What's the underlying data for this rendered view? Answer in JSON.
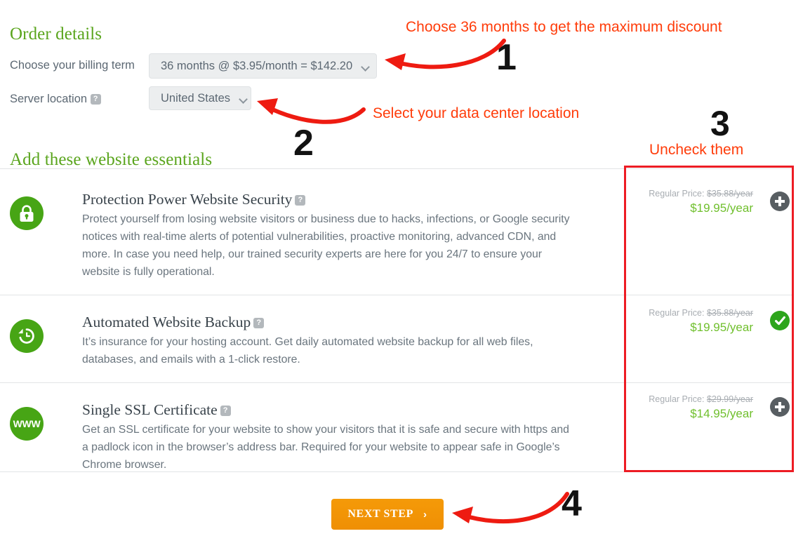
{
  "order": {
    "heading": "Order details",
    "billing_label": "Choose your billing term",
    "billing_value": "36 months @ $3.95/month = $142.20",
    "location_label": "Server location",
    "location_value": "United States",
    "help_glyph": "?"
  },
  "essentials": {
    "heading": "Add these website essentials",
    "products": [
      {
        "icon": "padlock-icon",
        "title": "Protection Power Website Security",
        "description": "Protect yourself from losing website visitors or business due to hacks, infections, or Google security notices with real-time alerts of potential vulnerabilities, proactive monitoring, advanced CDN, and more. In case you need help, our trained security experts are here for you 24/7 to ensure your website is fully operational.",
        "regular_price_label": "Regular Price:",
        "regular_price": "$35.88/year",
        "sale_price": "$19.95/year",
        "state": "add",
        "toggle_icon": "plus-icon"
      },
      {
        "icon": "backup-restore-icon",
        "title": "Automated Website Backup",
        "description": "It’s insurance for your hosting account. Get daily automated website backup for all web files, databases, and emails with a 1-click restore.",
        "regular_price_label": "Regular Price:",
        "regular_price": "$35.88/year",
        "sale_price": "$19.95/year",
        "state": "added",
        "toggle_icon": "check-icon"
      },
      {
        "icon": "www-icon",
        "icon_text": "WWW",
        "title": "Single SSL Certificate",
        "description": "Get an SSL certificate for your website to show your visitors that it is safe and secure with https and a padlock icon in the browser’s address bar. Required for your website to appear safe in Google’s Chrome browser.",
        "regular_price_label": "Regular Price:",
        "regular_price": "$29.99/year",
        "sale_price": "$14.95/year",
        "state": "add",
        "toggle_icon": "plus-icon"
      }
    ]
  },
  "annotations": [
    {
      "number": "1",
      "text": "Choose 36 months to get the maximum discount"
    },
    {
      "number": "2",
      "text": "Select your data center location"
    },
    {
      "number": "3",
      "text": "Uncheck them"
    },
    {
      "number": "4",
      "text": ""
    }
  ],
  "footer": {
    "next_step_label": "NEXT STEP",
    "next_step_chevron": "›"
  },
  "colors": {
    "green": "#5aa51d",
    "icon_green": "#47a515",
    "sale_green": "#6fbf2c",
    "annotation_red": "#ff3c0a",
    "box_red": "#ed1c24",
    "button_orange": "#f59a08"
  }
}
